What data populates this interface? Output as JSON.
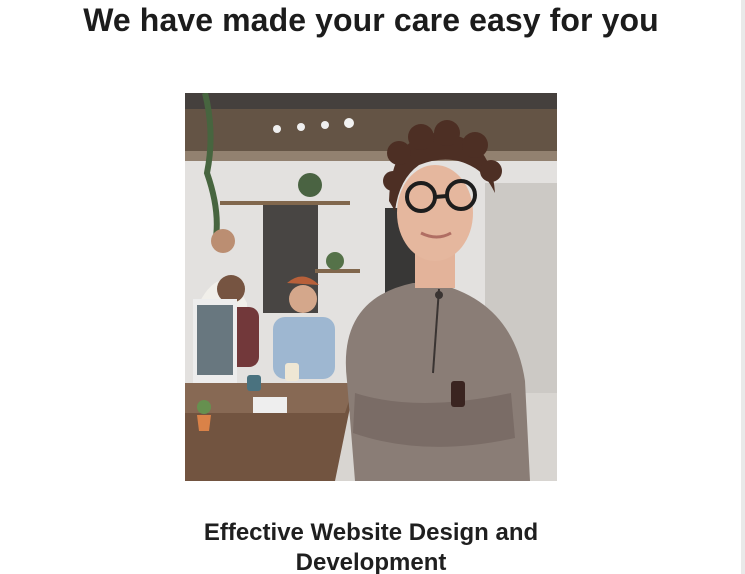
{
  "page": {
    "heading": "We have made your care easy for you",
    "feature_title_line1": "Effective Website Design and",
    "feature_title_line2": "Development"
  },
  "colors": {
    "heading": "#1c1c1c",
    "text": "#1f1f1f",
    "background": "#ffffff"
  }
}
